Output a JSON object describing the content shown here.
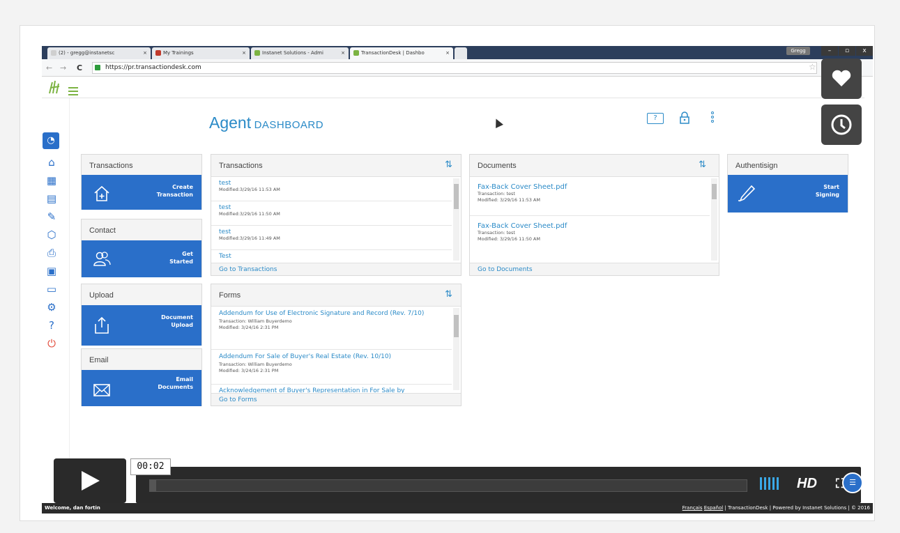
{
  "browser": {
    "tabs": [
      {
        "label": "(2) - gregg@instanetsc",
        "color": "#cfcfcf"
      },
      {
        "label": "My Trainings",
        "color": "#c0392b"
      },
      {
        "label": "Instanet Solutions - Admi",
        "color": "#7cb342"
      },
      {
        "label": "TransactionDesk | Dashbo",
        "color": "#7cb342"
      }
    ],
    "user_chip": "Gregg",
    "url": "https://pr.transactiondesk.com",
    "back_glyph": "←",
    "forward_glyph": "→",
    "reload_glyph": "C",
    "star_glyph": "☆"
  },
  "header": {
    "title_main": "Agent",
    "title_sub": "DASHBOARD",
    "help_glyph": "?",
    "lock_glyph": "🔒"
  },
  "left_column": {
    "transactions": {
      "title": "Transactions",
      "tile_label": "Create\nTransaction"
    },
    "contact": {
      "title": "Contact",
      "tile_label": "Get\nStarted"
    },
    "upload": {
      "title": "Upload",
      "tile_label": "Document\nUpload"
    },
    "email": {
      "title": "Email",
      "tile_label": "Email\nDocuments"
    }
  },
  "transactions_panel": {
    "title": "Transactions",
    "items": [
      {
        "title": "test",
        "meta": "Modified:3/29/16 11:53 AM"
      },
      {
        "title": "test",
        "meta": "Modified:3/29/16 11:50 AM"
      },
      {
        "title": "test",
        "meta": "Modified:3/29/16 11:49 AM"
      },
      {
        "title": "Test",
        "meta": ""
      }
    ],
    "footer": "Go to Transactions"
  },
  "documents_panel": {
    "title": "Documents",
    "items": [
      {
        "title": "Fax-Back Cover Sheet.pdf",
        "transaction": "Transaction: test",
        "meta": "Modified: 3/29/16 11:53 AM"
      },
      {
        "title": "Fax-Back Cover Sheet.pdf",
        "transaction": "Transaction: test",
        "meta": "Modified: 3/29/16 11:50 AM"
      }
    ],
    "footer": "Go to Documents"
  },
  "authentisign": {
    "title": "Authentisign",
    "tile_label": "Start\nSigning"
  },
  "forms_panel": {
    "title": "Forms",
    "items": [
      {
        "title": "Addendum for Use of Electronic Signature and Record (Rev. 7/10)",
        "transaction": "Transaction: William Buyerdemo",
        "meta": "Modified: 3/24/16 2:31 PM"
      },
      {
        "title": "Addendum For Sale of Buyer's Real Estate (Rev. 10/10)",
        "transaction": "Transaction: William Buyerdemo",
        "meta": "Modified: 3/24/16 2:31 PM"
      },
      {
        "title": "Acknowledgement of Buyer's Representation in For Sale by",
        "transaction": "",
        "meta": ""
      }
    ],
    "footer": "Go to Forms"
  },
  "video": {
    "time": "00:02",
    "hd_label": "HD",
    "progress": 0.01
  },
  "footer": {
    "welcome": "Welcome, dan fortin",
    "lang_fr": "Français",
    "lang_es": "Español",
    "credits": "| TransactionDesk | Powered by Instanet Solutions | © 2016"
  },
  "colors": {
    "accent_blue": "#2a6fc9",
    "link_blue": "#2a8ac7",
    "brand_green": "#7cb342",
    "logout_red": "#e24b3b"
  }
}
